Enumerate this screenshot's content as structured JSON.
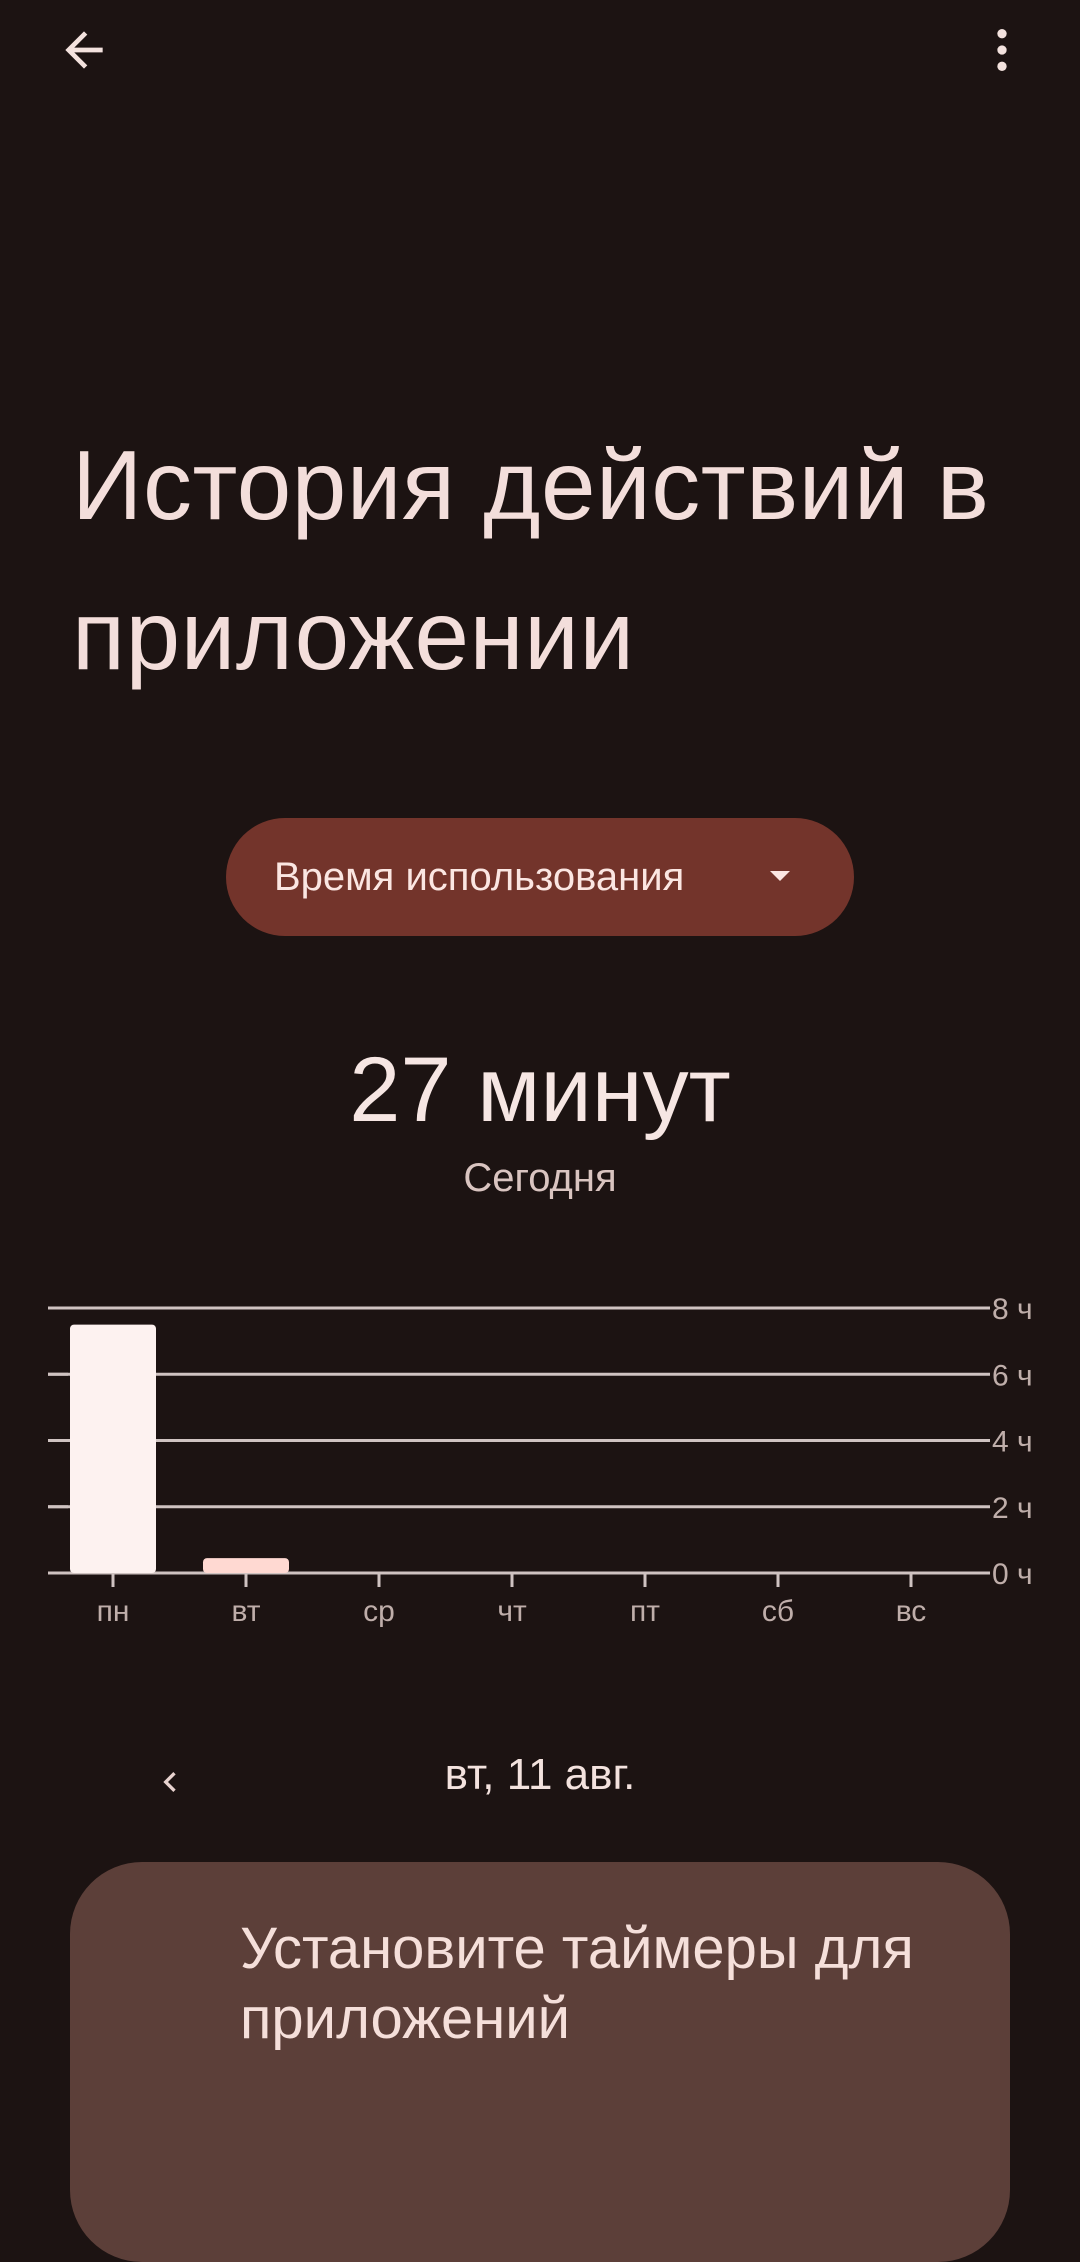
{
  "title": "История действий в приложении",
  "metric_selector": {
    "selected": "Время использования"
  },
  "summary": {
    "value": "27 минут",
    "period": "Сегодня"
  },
  "chart_data": {
    "type": "bar",
    "categories": [
      "пн",
      "вт",
      "ср",
      "чт",
      "пт",
      "сб",
      "вс"
    ],
    "values": [
      7.5,
      0.45,
      0,
      0,
      0,
      0,
      0
    ],
    "selected_index": 1,
    "y_ticks": [
      "0 ч",
      "2 ч",
      "4 ч",
      "6 ч",
      "8 ч"
    ],
    "ylim": [
      0,
      8
    ],
    "grid": true,
    "colors": {
      "bar": "#fdf2f0",
      "bar_selected": "#ffd9d2",
      "grid": "#cfc3c1",
      "label": "#bfaeaa"
    }
  },
  "date_navigation": {
    "date": "вт, 11 авг."
  },
  "timer_card": {
    "title": "Установите таймеры для приложений"
  },
  "icons": {
    "back": "arrow-back-icon",
    "more": "more-vert-icon",
    "dropdown": "caret-down-icon",
    "prev": "chevron-left-icon"
  },
  "colors": {
    "background": "#1c1312",
    "accent": "#73342b",
    "card": "#5c3f39"
  }
}
